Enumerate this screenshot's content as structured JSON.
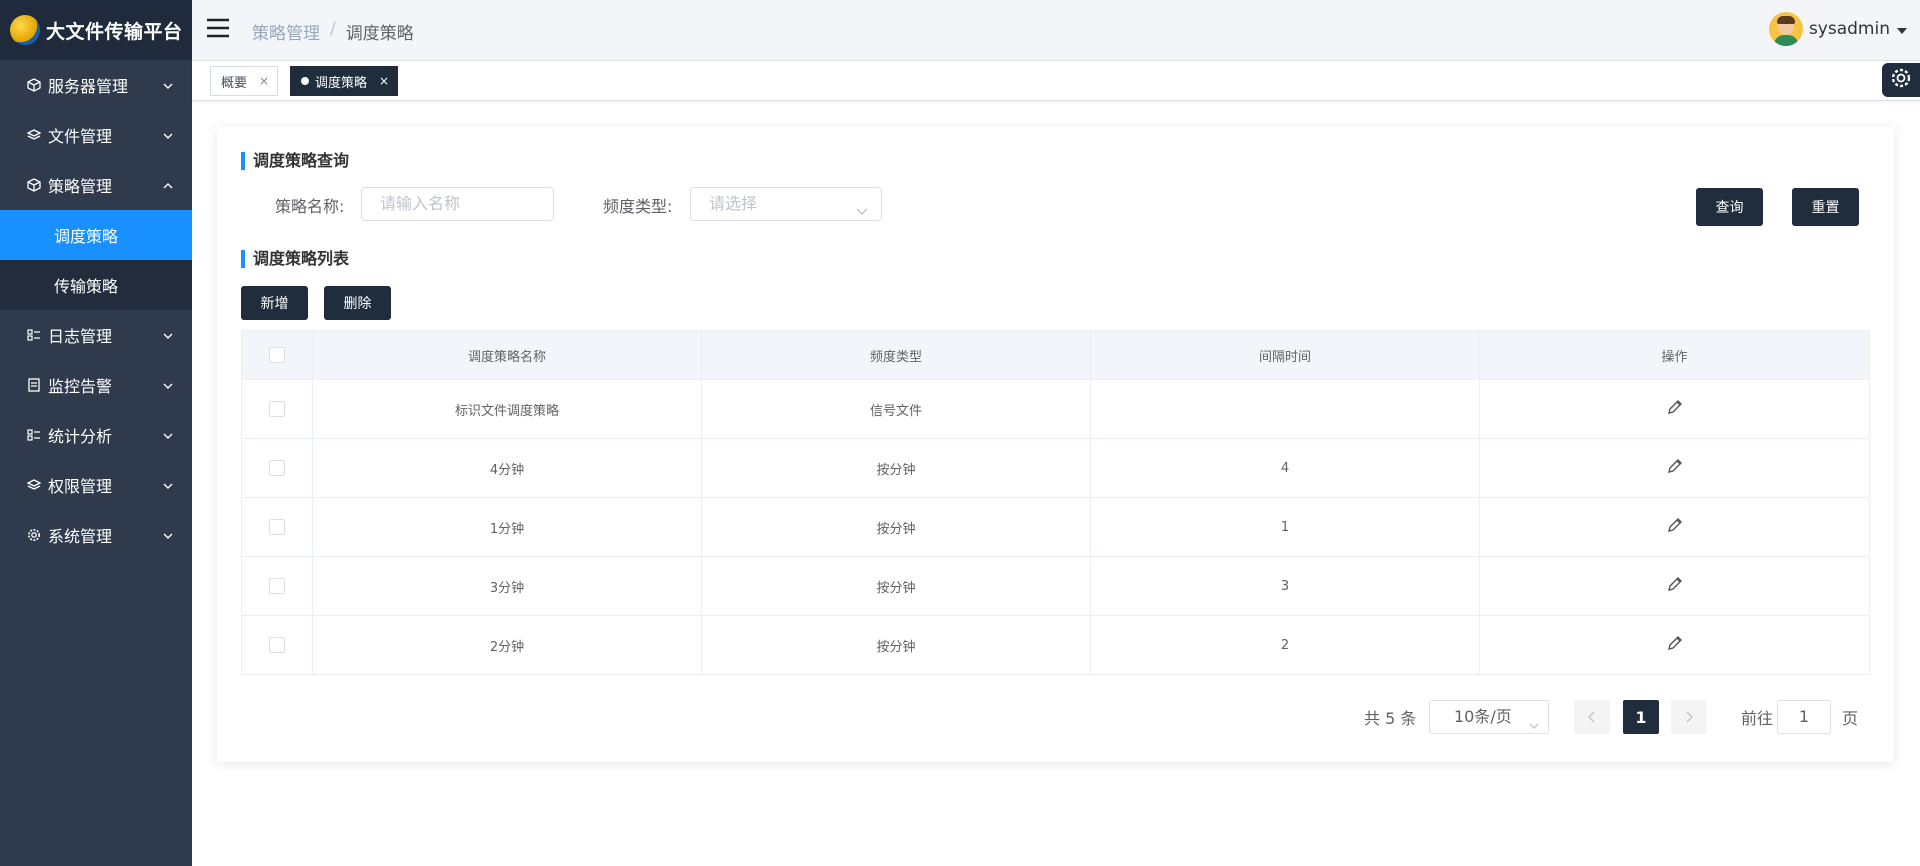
{
  "app": {
    "title": "大文件传输平台"
  },
  "sidebar": {
    "items": [
      {
        "label": "服务器管理",
        "icon": "cube-icon"
      },
      {
        "label": "文件管理",
        "icon": "layers-icon"
      },
      {
        "label": "策略管理",
        "icon": "box-icon",
        "expanded": true,
        "children": [
          {
            "label": "调度策略",
            "active": true
          },
          {
            "label": "传输策略"
          }
        ]
      },
      {
        "label": "日志管理",
        "icon": "list-icon"
      },
      {
        "label": "监控告警",
        "icon": "doc-icon"
      },
      {
        "label": "统计分析",
        "icon": "list-icon"
      },
      {
        "label": "权限管理",
        "icon": "layers-icon"
      },
      {
        "label": "系统管理",
        "icon": "gear-icon"
      }
    ]
  },
  "header": {
    "breadcrumb": [
      "策略管理",
      "调度策略"
    ],
    "breadcrumb_sep": "/",
    "username": "sysadmin"
  },
  "tabs": [
    {
      "label": "概要",
      "close": "×"
    },
    {
      "label": "调度策略",
      "close": "×",
      "active": true
    }
  ],
  "query": {
    "title": "调度策略查询",
    "name_label": "策略名称:",
    "name_placeholder": "请输入名称",
    "type_label": "频度类型:",
    "type_placeholder": "请选择",
    "search_label": "查询",
    "reset_label": "重置"
  },
  "list": {
    "title": "调度策略列表",
    "add_label": "新增",
    "delete_label": "删除",
    "columns": [
      "调度策略名称",
      "频度类型",
      "间隔时间",
      "操作"
    ],
    "rows": [
      {
        "name": "标识文件调度策略",
        "type": "信号文件",
        "interval": ""
      },
      {
        "name": "4分钟",
        "type": "按分钟",
        "interval": "4"
      },
      {
        "name": "1分钟",
        "type": "按分钟",
        "interval": "1"
      },
      {
        "name": "3分钟",
        "type": "按分钟",
        "interval": "3"
      },
      {
        "name": "2分钟",
        "type": "按分钟",
        "interval": "2"
      }
    ]
  },
  "pagination": {
    "total_text": "共 5 条",
    "page_size": "10条/页",
    "current_page": "1",
    "goto_label": "前往",
    "goto_value": "1",
    "page_suffix": "页"
  },
  "colors": {
    "sidebar_bg": "#2f3a4d",
    "active_blue": "#1890ff",
    "dark_btn": "#1f2d3d"
  }
}
